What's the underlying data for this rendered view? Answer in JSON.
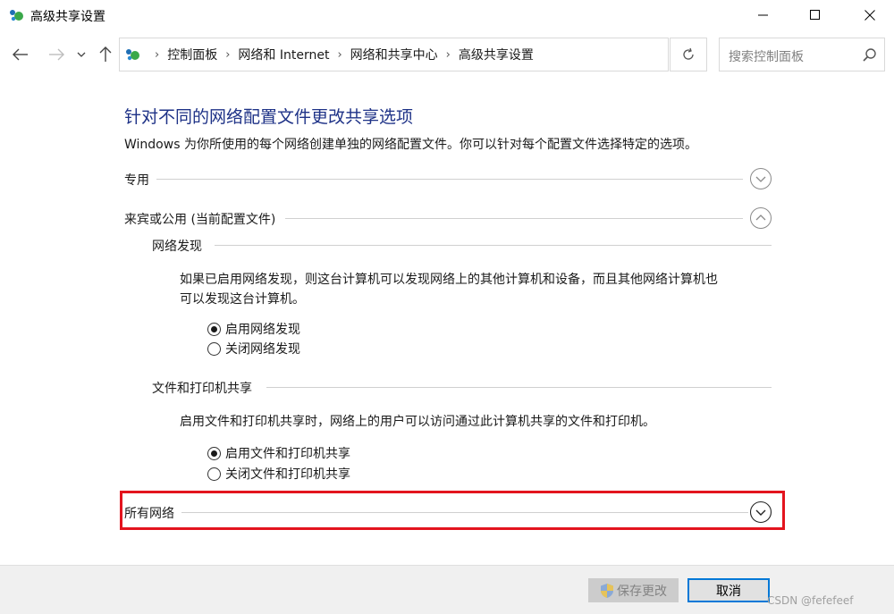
{
  "window": {
    "title": "高级共享设置",
    "icon": "network-sharing-icon"
  },
  "address": {
    "crumbs": [
      "控制面板",
      "网络和 Internet",
      "网络和共享中心",
      "高级共享设置"
    ],
    "search_placeholder": "搜索控制面板"
  },
  "main": {
    "title": "针对不同的网络配置文件更改共享选项",
    "description": "Windows 为你所使用的每个网络创建单独的网络配置文件。你可以针对每个配置文件选择特定的选项。",
    "profiles": {
      "private": {
        "label": "专用",
        "expanded": false
      },
      "guest_public": {
        "label": "来宾或公用 (当前配置文件)",
        "expanded": true,
        "network_discovery": {
          "heading": "网络发现",
          "description_line1": "如果已启用网络发现，则这台计算机可以发现网络上的其他计算机和设备，而且其他网络计算机也",
          "description_line2": "可以发现这台计算机。",
          "options": [
            {
              "label": "启用网络发现",
              "checked": true
            },
            {
              "label": "关闭网络发现",
              "checked": false
            }
          ]
        },
        "file_printer_sharing": {
          "heading": "文件和打印机共享",
          "description": "启用文件和打印机共享时，网络上的用户可以访问通过此计算机共享的文件和打印机。",
          "options": [
            {
              "label": "启用文件和打印机共享",
              "checked": true
            },
            {
              "label": "关闭文件和打印机共享",
              "checked": false
            }
          ]
        }
      },
      "all_networks": {
        "label": "所有网络",
        "expanded": false,
        "highlighted": true
      }
    }
  },
  "footer": {
    "save_label": "保存更改",
    "save_enabled": false,
    "cancel_label": "取消",
    "watermark": "CSDN @fefefeef"
  },
  "colors": {
    "title_blue": "#1e3287",
    "highlight_red": "#e3141e",
    "accent_blue": "#0078d7"
  }
}
